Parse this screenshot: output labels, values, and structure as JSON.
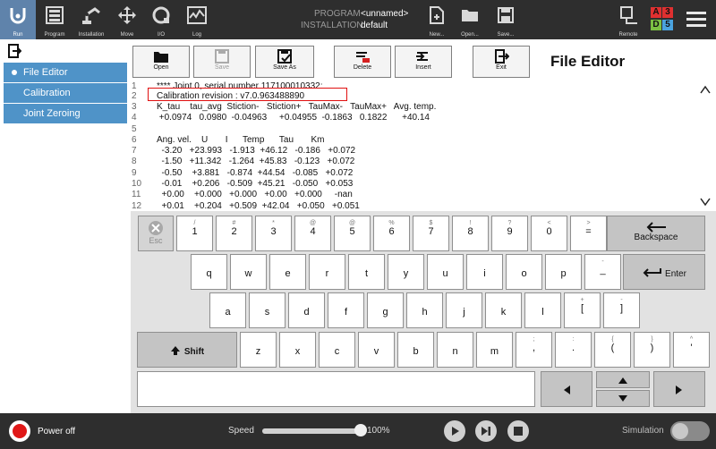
{
  "topbar": {
    "nav": [
      {
        "label": "Run",
        "icon": "ur-logo-icon"
      },
      {
        "label": "Program",
        "icon": "program-icon"
      },
      {
        "label": "Installation",
        "icon": "robot-arm-icon"
      },
      {
        "label": "Move",
        "icon": "move-arrows-icon"
      },
      {
        "label": "I/O",
        "icon": "io-icon"
      },
      {
        "label": "Log",
        "icon": "log-icon"
      }
    ],
    "program_label": "PROGRAM",
    "program_value": "<unnamed>",
    "installation_label": "INSTALLATION",
    "installation_value": "default",
    "file_buttons": [
      {
        "label": "New...",
        "icon": "new-file-icon"
      },
      {
        "label": "Open...",
        "icon": "open-folder-icon"
      },
      {
        "label": "Save...",
        "icon": "save-icon"
      }
    ],
    "remote_label": "Remote",
    "abcd": [
      {
        "letter": "A",
        "color": "#e03030"
      },
      {
        "letter": "3",
        "color": "#e03030"
      },
      {
        "letter": "D",
        "color": "#7bc043"
      },
      {
        "letter": "5",
        "color": "#4aa3df"
      }
    ]
  },
  "sidebar": {
    "items": [
      {
        "label": "File Editor",
        "active": true
      },
      {
        "label": "Calibration",
        "active": false
      },
      {
        "label": "Joint Zeroing",
        "active": false
      }
    ]
  },
  "toolbar": {
    "open": "Open",
    "save": "Save",
    "save_as": "Save As",
    "delete": "Delete",
    "insert": "Insert",
    "exit": "Exit"
  },
  "page_title": "File Editor",
  "editor": {
    "lines": [
      {
        "n": "1",
        "text": "**** Joint 0, serial number 117100010332:"
      },
      {
        "n": "2",
        "text": "Calibration revision : v7.0.963488890"
      },
      {
        "n": "3",
        "text": "K_tau    tau_avg  Stiction-   Stiction+   TauMax-   TauMax+   Avg. temp."
      },
      {
        "n": "4",
        "text": " +0.0974   0.0980  -0.04963     +0.04955  -0.1863   0.1822      +40.14"
      },
      {
        "n": "5",
        "text": ""
      },
      {
        "n": "6",
        "text": "Ang. vel.    U       I      Temp      Tau       Km"
      },
      {
        "n": "7",
        "text": "  -3.20   +23.993   -1.913  +46.12   -0.186   +0.072"
      },
      {
        "n": "8",
        "text": "  -1.50   +11.342   -1.264  +45.83   -0.123   +0.072"
      },
      {
        "n": "9",
        "text": "  -0.50    +3.881   -0.874  +44.54   -0.085   +0.072"
      },
      {
        "n": "10",
        "text": "  -0.01    +0.206   -0.509  +45.21   -0.050   +0.053"
      },
      {
        "n": "11",
        "text": "  +0.00    +0.000   +0.000   +0.00   +0.000     -nan"
      },
      {
        "n": "12",
        "text": "  +0.01    +0.204   +0.509  +42.04   +0.050   +0.051"
      }
    ]
  },
  "keyboard": {
    "esc": "Esc",
    "row1": [
      {
        "main": "1",
        "sub": "/"
      },
      {
        "main": "2",
        "sub": "#"
      },
      {
        "main": "3",
        "sub": "*"
      },
      {
        "main": "4",
        "sub": "@"
      },
      {
        "main": "5",
        "sub": "@"
      },
      {
        "main": "6",
        "sub": "%"
      },
      {
        "main": "7",
        "sub": "$"
      },
      {
        "main": "8",
        "sub": "!"
      },
      {
        "main": "9",
        "sub": "?"
      },
      {
        "main": "0",
        "sub": "<"
      },
      {
        "main": "=",
        "sub": ">"
      }
    ],
    "backspace": "Backspace",
    "row2": [
      "q",
      "w",
      "e",
      "r",
      "t",
      "y",
      "u",
      "i",
      "o",
      "p",
      "_"
    ],
    "row2_last_sub": "-",
    "enter": "Enter",
    "row3": [
      "a",
      "s",
      "d",
      "f",
      "g",
      "h",
      "j",
      "k",
      "l",
      "[",
      "]"
    ],
    "row3_subs": [
      "",
      "",
      "",
      "",
      "",
      "",
      "",
      "",
      "",
      "+",
      "-"
    ],
    "shift": "Shift",
    "row4": [
      {
        "main": "z",
        "sub": ""
      },
      {
        "main": "x",
        "sub": ""
      },
      {
        "main": "c",
        "sub": ""
      },
      {
        "main": "v",
        "sub": ""
      },
      {
        "main": "b",
        "sub": ""
      },
      {
        "main": "n",
        "sub": ""
      },
      {
        "main": "m",
        "sub": ""
      },
      {
        "main": ",",
        "sub": ";"
      },
      {
        "main": ".",
        "sub": ":"
      },
      {
        "main": "(",
        "sub": "{"
      },
      {
        "main": ")",
        "sub": "}"
      },
      {
        "main": "'",
        "sub": "^"
      }
    ]
  },
  "bottombar": {
    "power": "Power off",
    "speed_label": "Speed",
    "speed_value": "100%",
    "speed_fraction": 1.0,
    "simulation": "Simulation"
  }
}
